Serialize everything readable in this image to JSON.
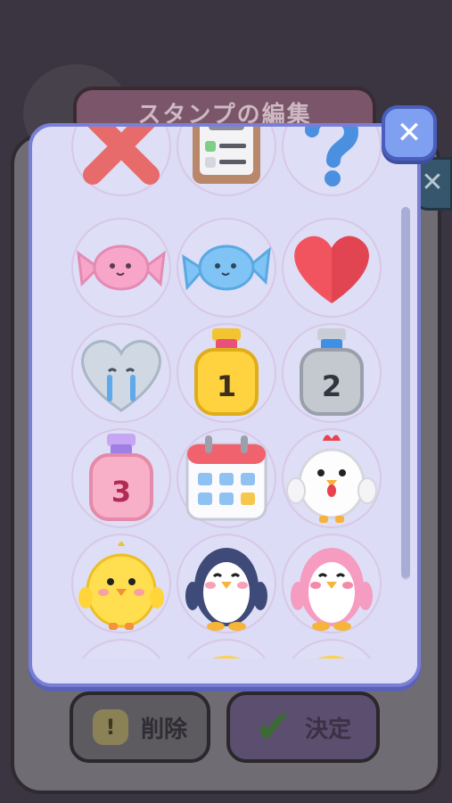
{
  "background": {
    "title": "スタンプの編集",
    "delete_label": "削除",
    "confirm_label": "決定",
    "delete_glyph": "!",
    "close_glyph": "✕"
  },
  "dialog": {
    "close_glyph": "✕",
    "stamps": [
      {
        "name": "x-mark",
        "label": ""
      },
      {
        "name": "checklist-clipboard",
        "label": ""
      },
      {
        "name": "question-mark",
        "label": ""
      },
      {
        "name": "pink-candy",
        "label": ""
      },
      {
        "name": "blue-candy",
        "label": ""
      },
      {
        "name": "red-heart",
        "label": ""
      },
      {
        "name": "crying-heart",
        "label": ""
      },
      {
        "name": "gold-medal",
        "label": "1"
      },
      {
        "name": "silver-medal",
        "label": "2"
      },
      {
        "name": "pink-medal",
        "label": "3"
      },
      {
        "name": "calendar",
        "label": ""
      },
      {
        "name": "chicken",
        "label": ""
      },
      {
        "name": "chick",
        "label": ""
      },
      {
        "name": "penguin",
        "label": ""
      },
      {
        "name": "pink-penguin",
        "label": ""
      }
    ]
  },
  "colors": {
    "panel_bg": "#dcdcf6",
    "panel_border": "#7a7fd6",
    "close_bg": "#7f9ff0"
  }
}
